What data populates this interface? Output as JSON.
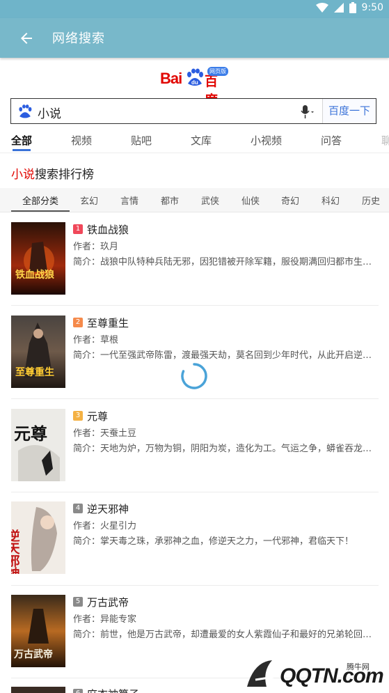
{
  "status": {
    "time": "9:50",
    "battery_level": "8"
  },
  "appbar": {
    "title": "网络搜索"
  },
  "logo": {
    "text_left": "Bai",
    "text_mid": "du",
    "text_right": "百度",
    "badge": "网页版"
  },
  "search": {
    "value": "小说",
    "button_label": "百度一下"
  },
  "tabs": [
    {
      "label": "全部",
      "active": true
    },
    {
      "label": "视频"
    },
    {
      "label": "贴吧"
    },
    {
      "label": "文库"
    },
    {
      "label": "小视频"
    },
    {
      "label": "问答"
    },
    {
      "label": "聊"
    }
  ],
  "rank": {
    "highlight": "小说",
    "rest": "搜索排行榜"
  },
  "categories": [
    {
      "label": "全部分类",
      "active": true
    },
    {
      "label": "玄幻"
    },
    {
      "label": "言情"
    },
    {
      "label": "都市"
    },
    {
      "label": "武侠"
    },
    {
      "label": "仙侠"
    },
    {
      "label": "奇幻"
    },
    {
      "label": "科幻"
    },
    {
      "label": "历史"
    }
  ],
  "books": [
    {
      "rank": "1",
      "title": "铁血战狼",
      "author": "作者：玖月",
      "desc": "简介：战狼中队特种兵陆无邪，因犯错被开除军籍，服役期满回归都市生…",
      "badge_color": "#f0485a"
    },
    {
      "rank": "2",
      "title": "至尊重生",
      "author": "作者：草根",
      "desc": "简介：一代至强武帝陈雷，渡最强天劫，莫名回到少年时代，从此开启逆…",
      "badge_color": "#f58a4b"
    },
    {
      "rank": "3",
      "title": "元尊",
      "author": "作者：天蚕土豆",
      "desc": "简介：天地为炉，万物为铜，阴阳为炭，造化为工。气运之争，蟒雀吞龙…",
      "badge_color": "#f4b143"
    },
    {
      "rank": "4",
      "title": "逆天邪神",
      "author": "作者：火星引力",
      "desc": "简介：掌天毒之珠，承邪神之血，修逆天之力，一代邪神，君临天下！",
      "badge_color": "#8a8a8a"
    },
    {
      "rank": "5",
      "title": "万古武帝",
      "author": "作者：异能专家",
      "desc": "简介：前世，他是万古武帝，却遭最爱的女人紫霞仙子和最好的兄弟轮回…",
      "badge_color": "#8a8a8a"
    },
    {
      "rank": "6",
      "title": "麻衣神算子",
      "author": "",
      "desc": "",
      "badge_color": "#8a8a8a"
    }
  ],
  "covers": [
    {
      "caption": "铁血战狼"
    },
    {
      "caption": "至尊重生"
    },
    {
      "caption": "元尊"
    },
    {
      "caption": "逆天邪神"
    },
    {
      "caption": "万古武帝"
    }
  ],
  "watermark": {
    "label": "腾牛网",
    "text": "QQTN.com"
  }
}
